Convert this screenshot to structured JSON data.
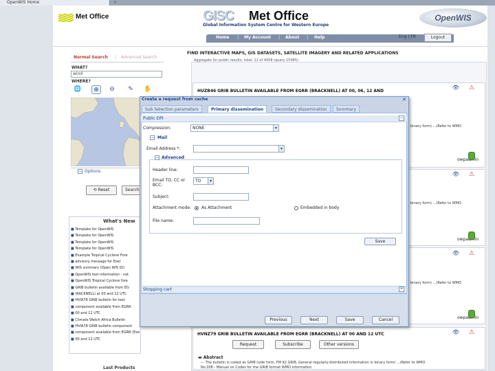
{
  "browser": {
    "tab_title": "OpenWIS Home",
    "tab_close": "×"
  },
  "header": {
    "logo_text": "Met Office",
    "gisc_title": "GISC",
    "gisc_org": "Met Office",
    "gisc_subtitle": "Global Information System Centre for Western Europe",
    "openwis_logo": "OpenWIS",
    "nav": [
      "Home",
      "My Account",
      "About",
      "Help"
    ],
    "lang": "Eng | FR",
    "logout": "Logout"
  },
  "left": {
    "tab_normal": "Normal Search",
    "tab_advanced": "Advanced Search",
    "what_label": "WHAT?",
    "what_value": "wind",
    "where_label": "WHERE?",
    "options_label": "Options",
    "reset_button": "Reset",
    "search_button": "Search",
    "whats_new_title": "What's New",
    "news": [
      "Template for OpenWIS",
      "Template for OpenWIS",
      "Template for OpenWIS",
      "Template for OpenWIS",
      "Example Tropical Cyclone Fore",
      "advisory message for Exer",
      "WIS summary (Open WIS ID)",
      "OpenWIS test information - not",
      "OpenWIS Tropical Cyclone fore",
      "GRIB bulletin available from EG",
      "(RACKNELL) at 00 and 12 UTC",
      "HVIA78 GRIB bulletin for test",
      "component available from EGRR",
      "00 and 12 UTC",
      "Climate Watch Africa Bulletin",
      "HVIA78 GRIB bulletin component",
      "component available from EGRR (Exeter) at",
      "00 and 12 UTC"
    ],
    "last_products": "Last Products"
  },
  "main": {
    "heading": "FIND INTERACTIVE MAPS, GIS DATASETS, SATELLITE IMAGERY AND RELATED APPLICATIONS",
    "results_count": "Aggregate for public results: total: 11 of 4958 (query 15985)",
    "results": [
      {
        "title": "HUZB46 GRIB BULLETIN AVAILABLE FROM EGRR (BRACKNELL) AT 00, 06, 12 AND",
        "snippet": "binary form) ...(Refer to WMO",
        "user": "owpadmin"
      },
      {
        "title": "",
        "snippet": "binary form) ...(Refer to WMO",
        "user": "owpadmin"
      },
      {
        "title": "",
        "snippet": "binary form) ...(Refer to WMO",
        "user": "owpadmin"
      },
      {
        "title": "HVNZ79 GRIB BULLETIN AVAILABLE FROM EGRR (BRACKNELL) AT 00 AND 12 UTC",
        "snippet": "",
        "user": ""
      }
    ],
    "result_buttons": [
      "Request",
      "Subscribe",
      "Other versions"
    ],
    "abstract_label": "Abstract",
    "abstract_text": "— The bulletin is coded as GRIB code form, FM 92 GRIB, General regularly-distributed information in binary form) ...(Refer to WMO",
    "abstract_text2": "No.306 - Manual on Codes for the GRIB format WMO information"
  },
  "modal": {
    "title": "Create a request from cache",
    "tabs": [
      "Sub Selection parameters",
      "Primary dissemination",
      "Secondary dissemination",
      "Summary"
    ],
    "panel_title": "Public DPI",
    "compression_label": "Compression:",
    "compression_value": "NONE",
    "mail_section": "Mail",
    "email_label": "Email Address *:",
    "email_value": "",
    "advanced_section": "Advanced",
    "header_line_label": "Header line:",
    "to_cc_bcc_label": "Email TO, CC or BCC:",
    "to_value": "TO",
    "subject_label": "Subject:",
    "attachment_label": "Attachment mode:",
    "attach_option": "As Attachment",
    "embedded_option": "Embedded in body",
    "file_name_label": "File name:",
    "save_button": "Save",
    "shopping_cart": "Shopping cart",
    "buttons": [
      "Previous",
      "Next",
      "Save",
      "Cancel"
    ]
  }
}
